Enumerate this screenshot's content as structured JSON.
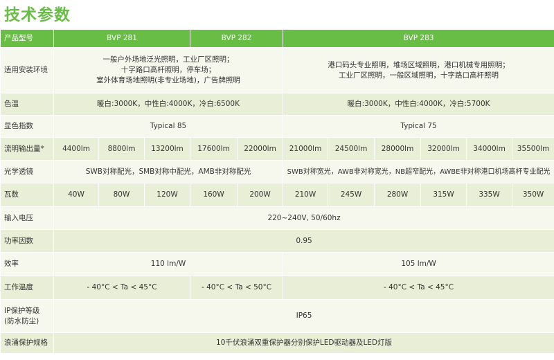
{
  "title": "技术参数",
  "header": {
    "label": "产品型号",
    "models": [
      "BVP 281",
      "BVP 282",
      "BVP 283"
    ]
  },
  "rows": {
    "env": {
      "label": "适用安装环境",
      "a": [
        "一般户外场地泛光照明，工业厂区照明；",
        "十字路口高杆照明，停车场；",
        "室外体育场地照明(非专业场地)，广告牌照明"
      ],
      "b": [
        "港口码头专业照明，堆场区域照明，港口机械专用照明；",
        "工业厂区照明，一般区域照明，十字路口高杆照明"
      ]
    },
    "cct": {
      "label": "色温",
      "a": "暖白:3000K，中性白:4000K，冷白:6500K",
      "b": "暖白:3000K，中性白:4000K，冷白:5700K"
    },
    "cri": {
      "label": "显色指数",
      "a": "Typical 85",
      "b": "Typical 75"
    },
    "flux": {
      "label": "流明输出量*",
      "values": [
        "4400lm",
        "8800lm",
        "13200lm",
        "17600lm",
        "22000lm",
        "21000lm",
        "24500lm",
        "28000lm",
        "32000lm",
        "34000lm",
        "35500lm"
      ]
    },
    "optic": {
      "label": "光学透镜",
      "a": "SWB对称配光，SMB对称中配光，AMB非对称配光",
      "b": "SWB对称宽光，AWB非对称宽光，NB超窄配光，AWBE非对称港口机场高杆专业配光"
    },
    "watt": {
      "label": "瓦数",
      "values": [
        "40W",
        "80W",
        "120W",
        "160W",
        "200W",
        "210W",
        "245W",
        "280W",
        "315W",
        "335W",
        "350W"
      ]
    },
    "voltage": {
      "label": "输入电压",
      "value": "220~240V, 50/60hz"
    },
    "pf": {
      "label": "功率因数",
      "value": "0.95"
    },
    "efficacy": {
      "label": "效率",
      "a": "110 lm/W",
      "b": "105 lm/W"
    },
    "temp": {
      "label": "工作温度",
      "a": "- 40°C < Ta < 45°C",
      "b": "- 40°C < Ta < 50°C",
      "c": "- 40°C < Ta < 45°C"
    },
    "ip": {
      "label1": "IP保护等级",
      "label2": "(防水防尘)",
      "value": "IP65"
    },
    "surge": {
      "label": "浪涌保护规格",
      "value": "10千伏浪涌双重保护器分别保护LED驱动器及LED灯版"
    }
  }
}
